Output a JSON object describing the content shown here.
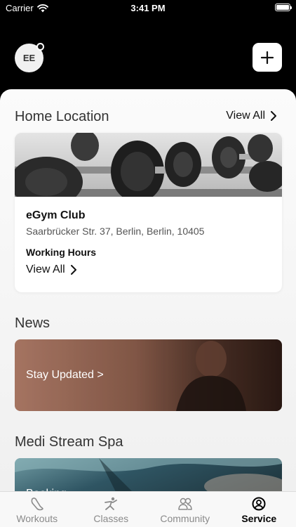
{
  "status": {
    "carrier": "Carrier",
    "time": "3:41 PM",
    "battery_level": 1.0
  },
  "header": {
    "avatar_initials": "EE"
  },
  "home_location": {
    "title": "Home Location",
    "view_all": "View All",
    "club_name": "eGym Club",
    "address": "Saarbrücker Str. 37, Berlin, Berlin, 10405",
    "hours_label": "Working Hours",
    "hours_view_all": "View All"
  },
  "news": {
    "title": "News",
    "banner_label": "Stay Updated >"
  },
  "spa": {
    "title": "Medi Stream Spa",
    "banner_label": "Booking"
  },
  "tabs": [
    {
      "label": "Workouts",
      "icon": "workouts-icon",
      "active": false
    },
    {
      "label": "Classes",
      "icon": "classes-icon",
      "active": false
    },
    {
      "label": "Community",
      "icon": "community-icon",
      "active": false
    },
    {
      "label": "Service",
      "icon": "service-icon",
      "active": true
    }
  ]
}
